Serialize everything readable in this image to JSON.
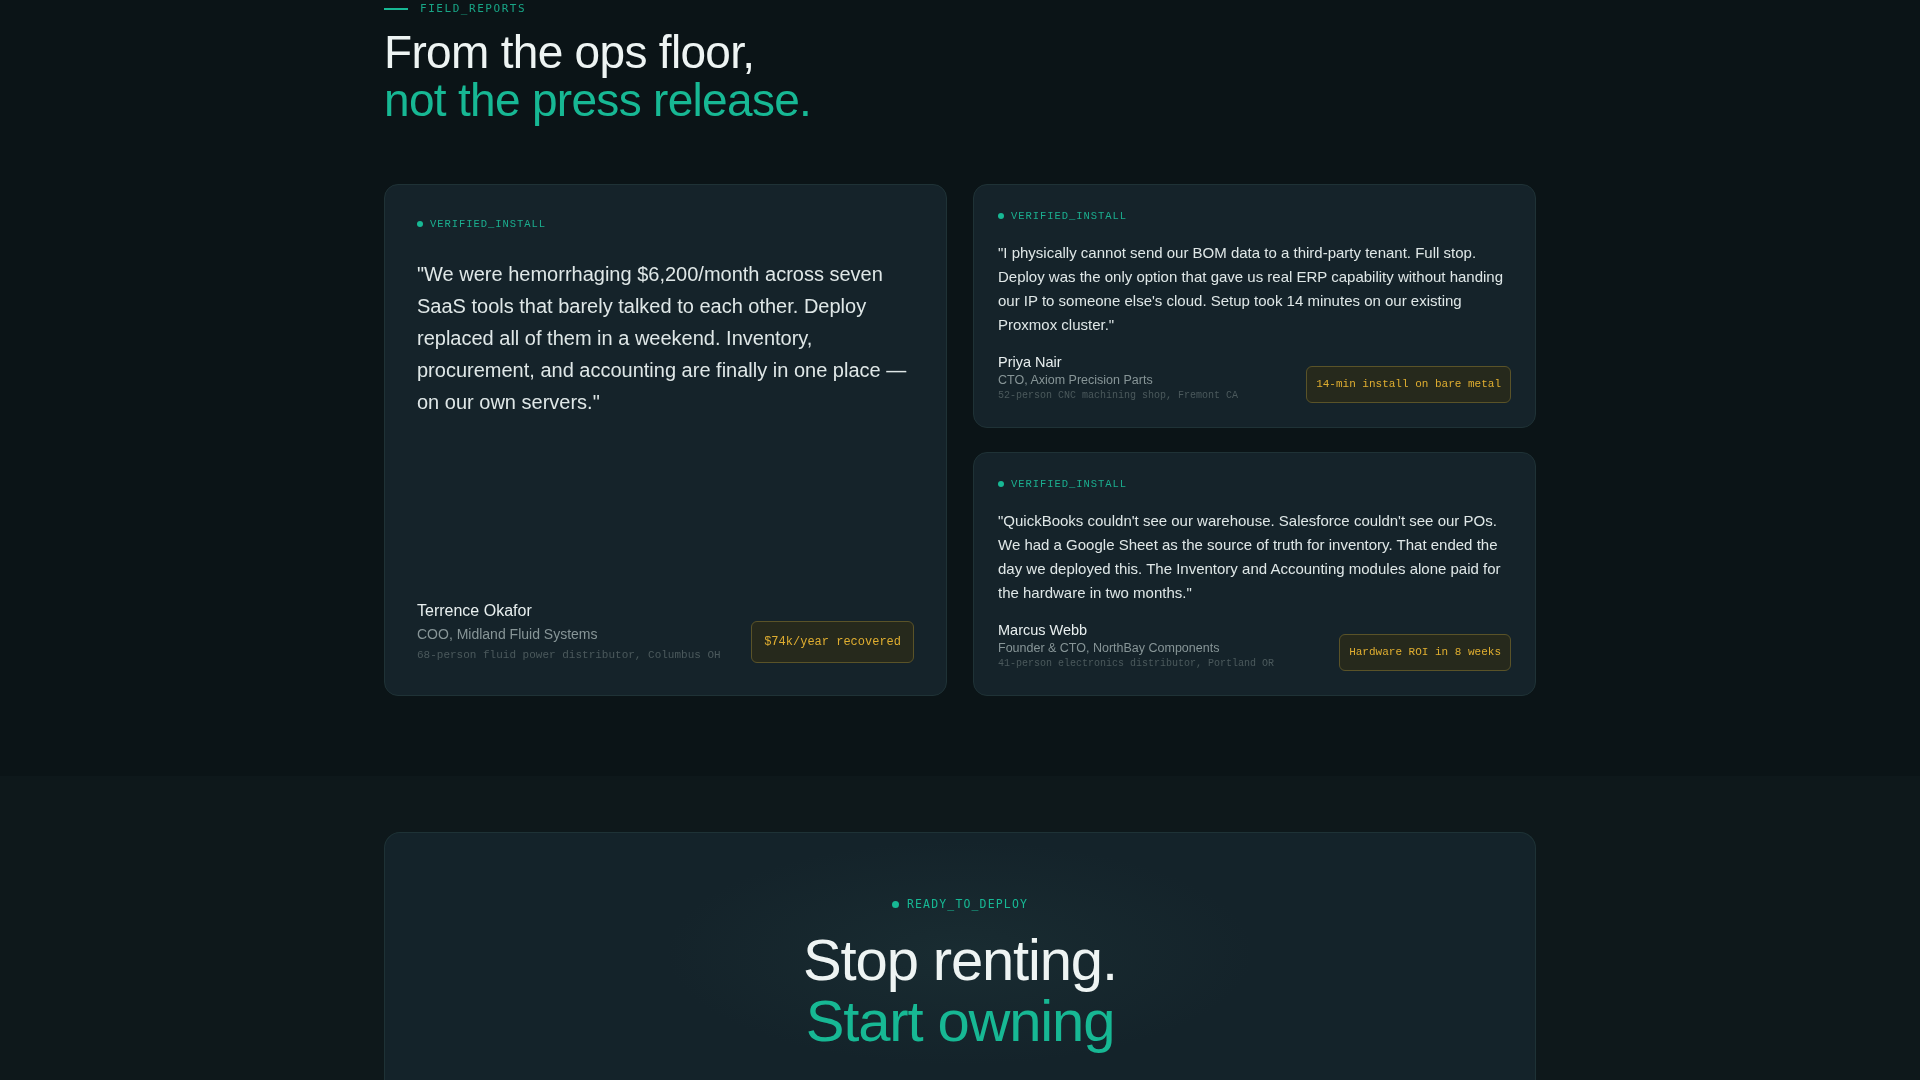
{
  "section_label": "FIELD_REPORTS",
  "heading": {
    "line_1": "From the ops floor,",
    "line_2": "not the press release."
  },
  "testimonials": [
    {
      "kind": "featured",
      "tag": "VERIFIED_INSTALL",
      "quote": "\"We were hemorrhaging $6,200/month across seven SaaS tools that barely talked to each other. Deploy replaced all of them in a weekend. Inventory, procurement, and accounting are finally in one place — on our own servers.\"",
      "name": "Terrence Okafor",
      "role": "COO, Midland Fluid Systems",
      "company_info": "68-person fluid power distributor, Columbus OH",
      "badge": "$74k/year recovered"
    },
    {
      "kind": "compact",
      "tag": "VERIFIED_INSTALL",
      "quote": "\"I physically cannot send our BOM data to a third-party tenant. Full stop. Deploy was the only option that gave us real ERP capability without handing our IP to someone else's cloud. Setup took 14 minutes on our existing Proxmox cluster.\"",
      "name": "Priya Nair",
      "role": "CTO, Axiom Precision Parts",
      "company_info": "52-person CNC machining shop, Fremont CA",
      "badge": "14-min install on bare metal"
    },
    {
      "kind": "compact",
      "tag": "VERIFIED_INSTALL",
      "quote": "\"QuickBooks couldn't see our warehouse. Salesforce couldn't see our POs. We had a Google Sheet as the source of truth for inventory. That ended the day we deployed this. The Inventory and Accounting modules alone paid for the hardware in two months.\"",
      "name": "Marcus Webb",
      "role": "Founder & CTO, NorthBay Components",
      "company_info": "41-person electronics distributor, Portland OR",
      "badge": "Hardware ROI in 8 weeks"
    }
  ],
  "cta": {
    "tag": "READY_TO_DEPLOY",
    "line_1": "Stop renting.",
    "line_2": "Start owning"
  }
}
